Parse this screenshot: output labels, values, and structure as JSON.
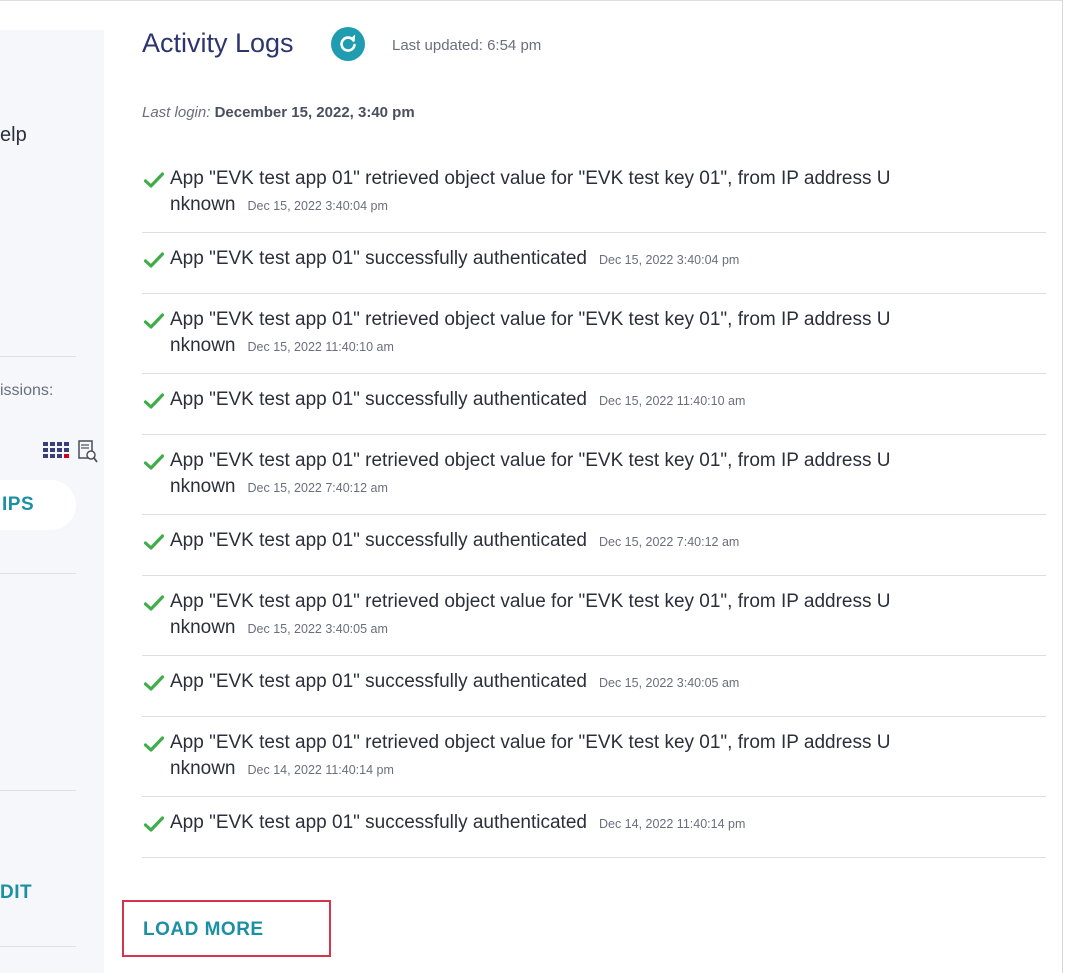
{
  "sidebar": {
    "help_label": "elp",
    "permissions_label": "issions:",
    "groups_button": "IPS",
    "edit_button": "DIT"
  },
  "header": {
    "title": "Activity Logs",
    "last_updated": "Last updated: 6:54 pm",
    "last_login_label": "Last login:",
    "last_login_value": "December 15, 2022, 3:40 pm"
  },
  "logs": [
    {
      "line1": "App \"EVK test app 01\" retrieved object value for \"EVK test key 01\", from IP address U",
      "line2": "nknown",
      "time": "Dec 15, 2022 3:40:04 pm"
    },
    {
      "line1": "App \"EVK test app 01\" successfully authenticated",
      "line2": "",
      "time": "Dec 15, 2022 3:40:04 pm"
    },
    {
      "line1": "App \"EVK test app 01\" retrieved object value for \"EVK test key 01\", from IP address U",
      "line2": "nknown",
      "time": "Dec 15, 2022 11:40:10 am"
    },
    {
      "line1": "App \"EVK test app 01\" successfully authenticated",
      "line2": "",
      "time": "Dec 15, 2022 11:40:10 am"
    },
    {
      "line1": "App \"EVK test app 01\" retrieved object value for \"EVK test key 01\", from IP address U",
      "line2": "nknown",
      "time": "Dec 15, 2022 7:40:12 am"
    },
    {
      "line1": "App \"EVK test app 01\" successfully authenticated",
      "line2": "",
      "time": "Dec 15, 2022 7:40:12 am"
    },
    {
      "line1": "App \"EVK test app 01\" retrieved object value for \"EVK test key 01\", from IP address U",
      "line2": "nknown",
      "time": "Dec 15, 2022 3:40:05 am"
    },
    {
      "line1": "App \"EVK test app 01\" successfully authenticated",
      "line2": "",
      "time": "Dec 15, 2022 3:40:05 am"
    },
    {
      "line1": "App \"EVK test app 01\" retrieved object value for \"EVK test key 01\", from IP address U",
      "line2": "nknown",
      "time": "Dec 14, 2022 11:40:14 pm"
    },
    {
      "line1": "App \"EVK test app 01\" successfully authenticated",
      "line2": "",
      "time": "Dec 14, 2022 11:40:14 pm"
    }
  ],
  "load_more_label": "LOAD MORE",
  "colors": {
    "accent": "#1b8fa3",
    "check": "#3fae49",
    "title": "#2c3570",
    "highlight": "#d6344a"
  }
}
